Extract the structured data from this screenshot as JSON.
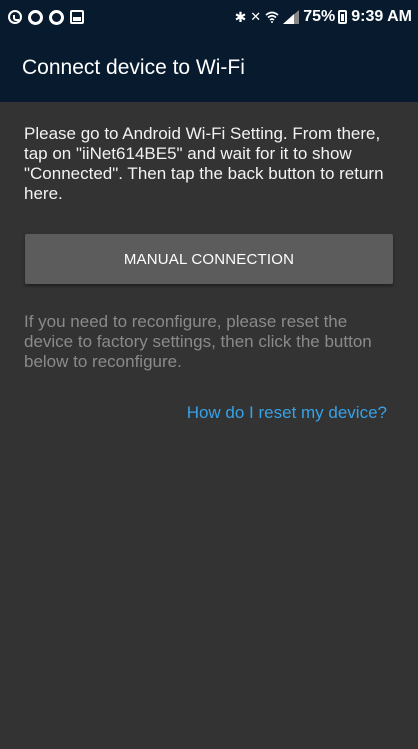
{
  "status_bar": {
    "icons_left": [
      "whatsapp-icon",
      "ring-icon",
      "ring-icon",
      "gallery-icon"
    ],
    "icons_right": [
      "bluetooth-icon",
      "mute-icon",
      "wifi-icon",
      "signal-icon"
    ],
    "battery": "75%",
    "time": "9:39 AM"
  },
  "app_bar": {
    "title": "Connect device to Wi-Fi"
  },
  "main": {
    "instructions": "Please go to Android Wi-Fi Setting. From there, tap on \"iiNet614BE5\" and wait for it to show \"Connected\". Then tap the back button to return here.",
    "manual_button_label": "MANUAL CONNECTION",
    "reconfigure_text": "If you need to reconfigure, please reset the device to factory settings, then click the button below to reconfigure.",
    "reset_link": "How do I reset my device?"
  },
  "colors": {
    "app_bar_bg": "#071a2e",
    "content_bg": "#333333",
    "button_bg": "#5c5c5c",
    "link": "#36a2e8",
    "muted_text": "#8a8a8a"
  }
}
